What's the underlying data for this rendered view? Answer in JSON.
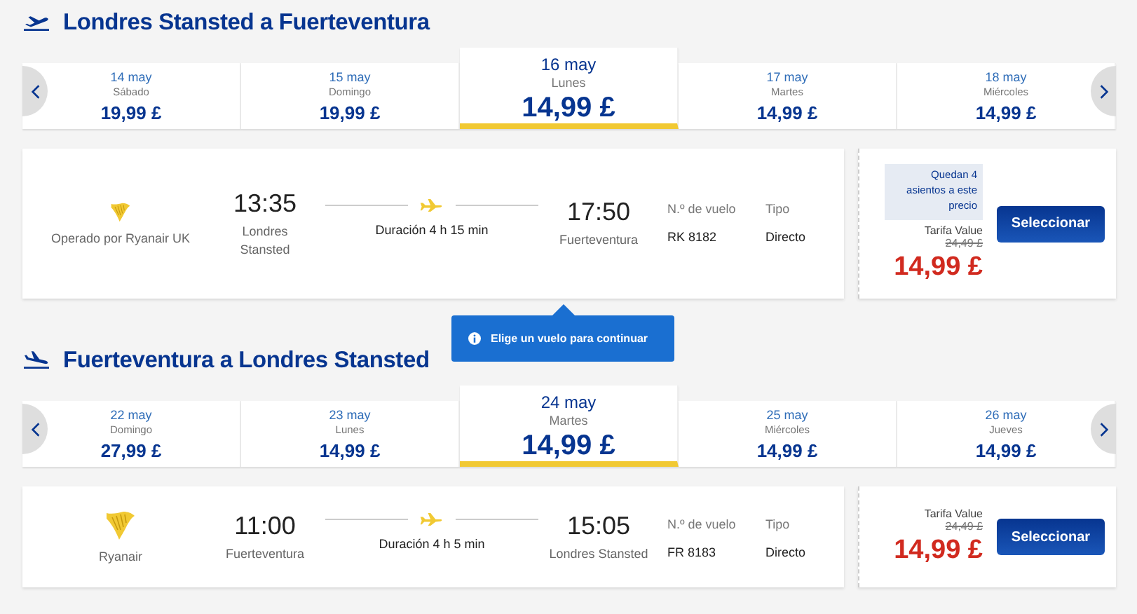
{
  "sections": [
    {
      "kind": "outbound",
      "title": "Londres Stansted a Fuerteventura",
      "dates": [
        {
          "date": "14 may",
          "day": "Sábado",
          "price": "19,99 £",
          "selected": false
        },
        {
          "date": "15 may",
          "day": "Domingo",
          "price": "19,99 £",
          "selected": false
        },
        {
          "date": "16 may",
          "day": "Lunes",
          "price": "14,99 £",
          "selected": true
        },
        {
          "date": "17 may",
          "day": "Martes",
          "price": "14,99 £",
          "selected": false
        },
        {
          "date": "18 may",
          "day": "Miércoles",
          "price": "14,99 £",
          "selected": false
        }
      ],
      "flight": {
        "operator": "Operado por Ryanair UK",
        "depart_time": "13:35",
        "depart_place": "Londres Stansted",
        "duration": "Duración 4 h 15 min",
        "arrive_time": "17:50",
        "arrive_place": "Fuerteventura",
        "flight_label": "N.º de vuelo",
        "flight_number": "RK 8182",
        "type_label": "Tipo",
        "type_value": "Directo",
        "seats_notice": "Quedan 4 asientos a este precio",
        "fare_label": "Tarifa Value",
        "old_price": "24,49 £",
        "price": "14,99 £",
        "button": "Seleccionar"
      },
      "tooltip": "Elige un vuelo para continuar"
    },
    {
      "kind": "inbound",
      "title": "Fuerteventura a Londres Stansted",
      "dates": [
        {
          "date": "22 may",
          "day": "Domingo",
          "price": "27,99 £",
          "selected": false
        },
        {
          "date": "23 may",
          "day": "Lunes",
          "price": "14,99 £",
          "selected": false
        },
        {
          "date": "24 may",
          "day": "Martes",
          "price": "14,99 £",
          "selected": true
        },
        {
          "date": "25 may",
          "day": "Miércoles",
          "price": "14,99 £",
          "selected": false
        },
        {
          "date": "26 may",
          "day": "Jueves",
          "price": "14,99 £",
          "selected": false
        }
      ],
      "flight": {
        "operator": "Ryanair",
        "depart_time": "11:00",
        "depart_place": "Fuerteventura",
        "duration": "Duración 4 h 5 min",
        "arrive_time": "15:05",
        "arrive_place": "Londres Stansted",
        "flight_label": "N.º de vuelo",
        "flight_number": "FR 8183",
        "type_label": "Tipo",
        "type_value": "Directo",
        "fare_label": "Tarifa Value",
        "old_price": "24,49 £",
        "price": "14,99 £",
        "button": "Seleccionar"
      }
    }
  ]
}
